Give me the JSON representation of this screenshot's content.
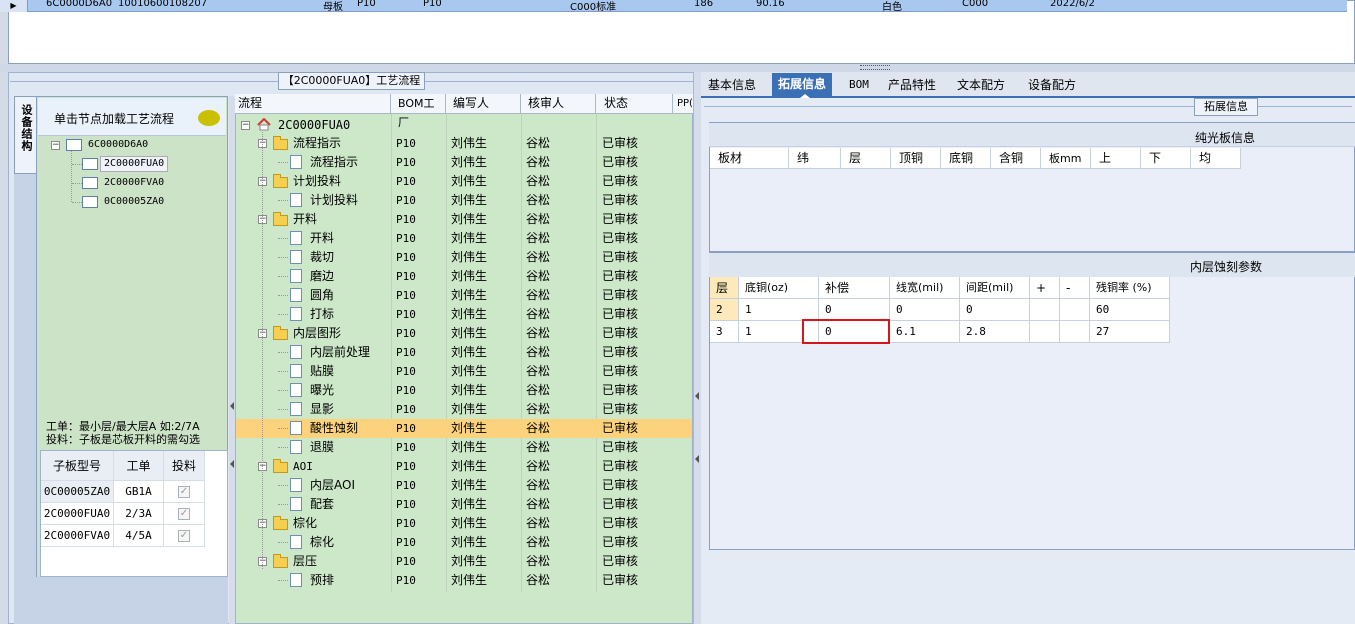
{
  "top_row": {
    "cells": [
      "6C0000D6A0",
      "10010600108207",
      "母板",
      "P10",
      "P10",
      "C000标准",
      "186",
      "90.16",
      "白色",
      "C000",
      "2022/6/2"
    ]
  },
  "workflow_panel": {
    "title": "【2C0000FUA0】工艺流程"
  },
  "side_tab": {
    "label": "设备结构"
  },
  "device_tree": {
    "header": "单击节点加载工艺流程",
    "root": "6C0000D6A0",
    "children": [
      "2C0000FUA0",
      "2C0000FVA0",
      "0C00005ZA0"
    ]
  },
  "hint": {
    "line1": "工单：最小层/最大层A 如:2/7A",
    "line2": "投料：子板是芯板开料的需勾选"
  },
  "sub_grid": {
    "headers": [
      "子板型号",
      "工单",
      "投料"
    ],
    "rows": [
      {
        "model": "0C00005ZA0",
        "order": "GB1A",
        "feed": "✓"
      },
      {
        "model": "2C0000FUA0",
        "order": "2/3A",
        "feed": "✓"
      },
      {
        "model": "2C0000FVA0",
        "order": "4/5A",
        "feed": "✓"
      }
    ]
  },
  "workflow_grid": {
    "headers": [
      "流程",
      "BOM工厂",
      "编写人",
      "核审人",
      "状态",
      "PP("
    ],
    "root": "2C0000FUA0",
    "rows": [
      {
        "name": "流程指示",
        "level": 1,
        "type": "folder",
        "factory": "P10",
        "writer": "刘伟生",
        "reviewer": "谷松",
        "status": "已审核"
      },
      {
        "name": "流程指示",
        "level": 2,
        "type": "doc",
        "factory": "P10",
        "writer": "刘伟生",
        "reviewer": "谷松",
        "status": "已审核"
      },
      {
        "name": "计划投料",
        "level": 1,
        "type": "folder",
        "factory": "P10",
        "writer": "刘伟生",
        "reviewer": "谷松",
        "status": "已审核"
      },
      {
        "name": "计划投料",
        "level": 2,
        "type": "doc",
        "factory": "P10",
        "writer": "刘伟生",
        "reviewer": "谷松",
        "status": "已审核"
      },
      {
        "name": "开料",
        "level": 1,
        "type": "folder",
        "factory": "P10",
        "writer": "刘伟生",
        "reviewer": "谷松",
        "status": "已审核"
      },
      {
        "name": "开料",
        "level": 2,
        "type": "doc",
        "factory": "P10",
        "writer": "刘伟生",
        "reviewer": "谷松",
        "status": "已审核"
      },
      {
        "name": "裁切",
        "level": 2,
        "type": "doc",
        "factory": "P10",
        "writer": "刘伟生",
        "reviewer": "谷松",
        "status": "已审核"
      },
      {
        "name": "磨边",
        "level": 2,
        "type": "doc",
        "factory": "P10",
        "writer": "刘伟生",
        "reviewer": "谷松",
        "status": "已审核"
      },
      {
        "name": "圆角",
        "level": 2,
        "type": "doc",
        "factory": "P10",
        "writer": "刘伟生",
        "reviewer": "谷松",
        "status": "已审核"
      },
      {
        "name": "打标",
        "level": 2,
        "type": "doc",
        "factory": "P10",
        "writer": "刘伟生",
        "reviewer": "谷松",
        "status": "已审核"
      },
      {
        "name": "内层图形",
        "level": 1,
        "type": "folder",
        "factory": "P10",
        "writer": "刘伟生",
        "reviewer": "谷松",
        "status": "已审核"
      },
      {
        "name": "内层前处理",
        "level": 2,
        "type": "doc",
        "factory": "P10",
        "writer": "刘伟生",
        "reviewer": "谷松",
        "status": "已审核"
      },
      {
        "name": "贴膜",
        "level": 2,
        "type": "doc",
        "factory": "P10",
        "writer": "刘伟生",
        "reviewer": "谷松",
        "status": "已审核"
      },
      {
        "name": "曝光",
        "level": 2,
        "type": "doc",
        "factory": "P10",
        "writer": "刘伟生",
        "reviewer": "谷松",
        "status": "已审核"
      },
      {
        "name": "显影",
        "level": 2,
        "type": "doc",
        "factory": "P10",
        "writer": "刘伟生",
        "reviewer": "谷松",
        "status": "已审核"
      },
      {
        "name": "酸性蚀刻",
        "level": 2,
        "type": "doc",
        "factory": "P10",
        "writer": "刘伟生",
        "reviewer": "谷松",
        "status": "已审核",
        "selected": true
      },
      {
        "name": "退膜",
        "level": 2,
        "type": "doc",
        "factory": "P10",
        "writer": "刘伟生",
        "reviewer": "谷松",
        "status": "已审核"
      },
      {
        "name": "AOI",
        "level": 1,
        "type": "folder",
        "factory": "P10",
        "writer": "刘伟生",
        "reviewer": "谷松",
        "status": "已审核"
      },
      {
        "name": "内层AOI",
        "level": 2,
        "type": "doc",
        "factory": "P10",
        "writer": "刘伟生",
        "reviewer": "谷松",
        "status": "已审核"
      },
      {
        "name": "配套",
        "level": 2,
        "type": "doc",
        "factory": "P10",
        "writer": "刘伟生",
        "reviewer": "谷松",
        "status": "已审核"
      },
      {
        "name": "棕化",
        "level": 1,
        "type": "folder",
        "factory": "P10",
        "writer": "刘伟生",
        "reviewer": "谷松",
        "status": "已审核"
      },
      {
        "name": "棕化",
        "level": 2,
        "type": "doc",
        "factory": "P10",
        "writer": "刘伟生",
        "reviewer": "谷松",
        "status": "已审核"
      },
      {
        "name": "层压",
        "level": 1,
        "type": "folder",
        "factory": "P10",
        "writer": "刘伟生",
        "reviewer": "谷松",
        "status": "已审核"
      },
      {
        "name": "预排",
        "level": 2,
        "type": "doc",
        "factory": "P10",
        "writer": "刘伟生",
        "reviewer": "谷松",
        "status": "已审核"
      }
    ]
  },
  "right_tabs": {
    "items": [
      "基本信息",
      "拓展信息",
      "BOM",
      "产品特性",
      "文本配方",
      "设备配方"
    ],
    "active": "拓展信息"
  },
  "extension": {
    "legend": "拓展信息",
    "board_section_title": "纯光板信息",
    "board_headers": [
      "板材",
      "纬",
      "层",
      "顶铜",
      "底铜",
      "含铜",
      "板mm",
      "上",
      "下",
      "均"
    ],
    "etch_section_title": "内层蚀刻参数",
    "etch_headers": [
      "层",
      "底铜(oz)",
      "补偿",
      "线宽(mil)",
      "间距(mil)",
      "+",
      "-",
      "残铜率 (%)"
    ],
    "etch_rows": [
      {
        "layer": "2",
        "base_cu": "1",
        "comp": "0",
        "width": "0",
        "space": "0",
        "plus": "",
        "minus": "",
        "residual": "60"
      },
      {
        "layer": "3",
        "base_cu": "1",
        "comp": "0",
        "width": "6.1",
        "space": "2.8",
        "plus": "",
        "minus": "",
        "residual": "27"
      }
    ]
  },
  "colors": {
    "accent": "#3b6fb6",
    "grid_green": "#cde8c9",
    "selected_row": "#fcd37c",
    "highlight_box": "#d8141c"
  }
}
